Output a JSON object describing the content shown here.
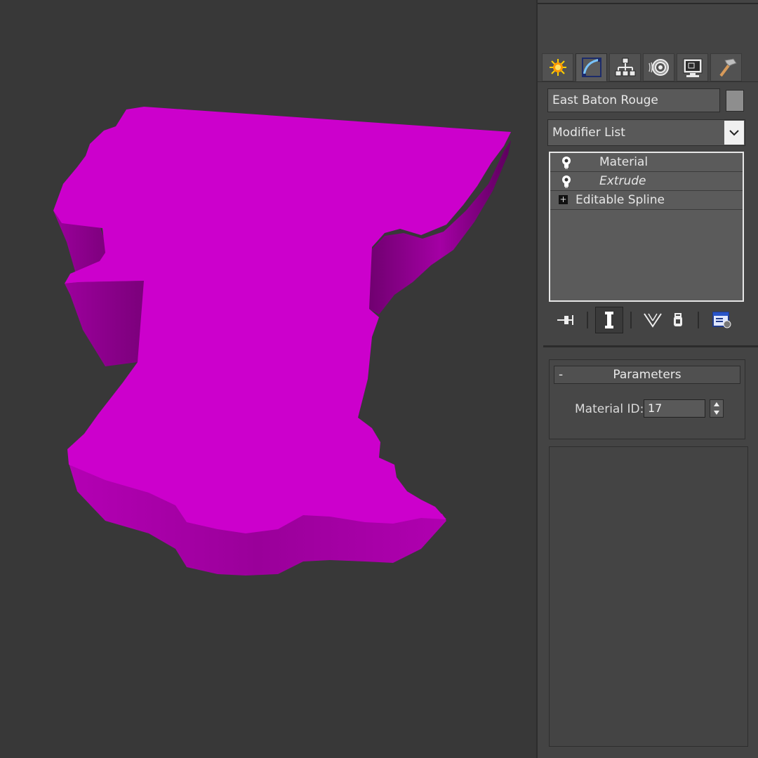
{
  "viewport": {
    "object_color": "#cc00cc",
    "background": "#383838"
  },
  "command_panel": {
    "tabs": [
      {
        "icon": "create-icon",
        "active": false
      },
      {
        "icon": "modify-icon",
        "active": true
      },
      {
        "icon": "hierarchy-icon",
        "active": false
      },
      {
        "icon": "motion-icon",
        "active": false
      },
      {
        "icon": "display-icon",
        "active": false
      },
      {
        "icon": "utilities-icon",
        "active": false
      }
    ],
    "object_name": "East Baton Rouge",
    "object_color_swatch": "#8e8e8e",
    "modifier_list": {
      "label": "Modifier List"
    },
    "stack": [
      {
        "label": "Material",
        "style": "normal",
        "icon": "lightbulb-icon"
      },
      {
        "label": "Extrude",
        "style": "italic",
        "icon": "lightbulb-icon"
      },
      {
        "label": "Editable Spline",
        "style": "base",
        "icon": "expand-plus-icon"
      }
    ],
    "parameters": {
      "title": "Parameters",
      "collapse_symbol": "-",
      "material_id_label": "Material ID:",
      "material_id_value": "17"
    }
  }
}
